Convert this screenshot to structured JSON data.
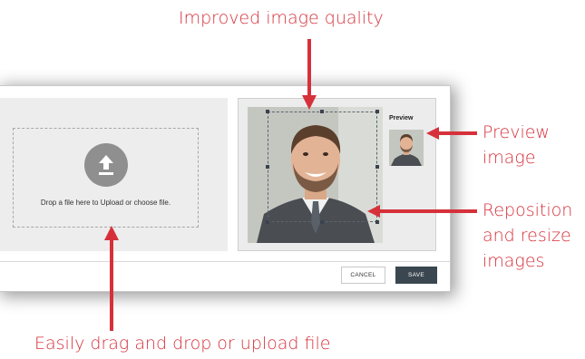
{
  "callouts": {
    "top": "Improved image quality",
    "preview_line1": "Preview",
    "preview_line2": "image",
    "reposition_line1": "Reposition",
    "reposition_line2": "and resize",
    "reposition_line3": "images",
    "bottom": "Easily drag and drop or upload file"
  },
  "dropzone": {
    "icon": "upload-icon",
    "text": "Drop a file here to Upload or choose file."
  },
  "preview": {
    "label": "Preview"
  },
  "footer": {
    "cancel_label": "CANCEL",
    "save_label": "SAVE"
  },
  "colors": {
    "callout": "#d6313b",
    "save_button": "#3a4750",
    "upload_circle": "#8f8f8f"
  }
}
